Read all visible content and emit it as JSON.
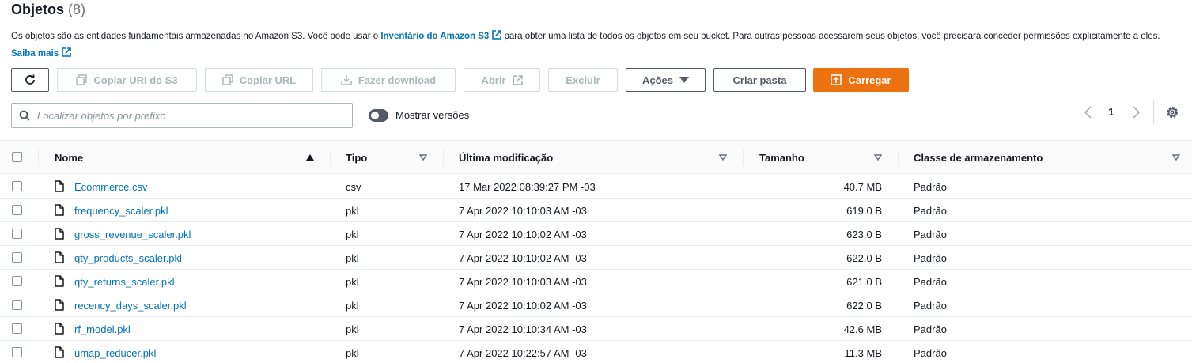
{
  "header": {
    "title": "Objetos",
    "count": "(8)"
  },
  "description": {
    "text1": "Os objetos são as entidades fundamentais armazenadas no Amazon S3. Você pode usar o ",
    "link1": "Inventário do Amazon S3",
    "text2": " para obter uma lista de todos os objetos em seu bucket. Para outras pessoas acessarem seus objetos, você precisará conceder permissões explicitamente a eles. ",
    "link2": "Saiba mais"
  },
  "toolbar": {
    "copy_uri": "Copiar URI do S3",
    "copy_url": "Copiar URL",
    "download": "Fazer download",
    "open": "Abrir",
    "delete": "Excluir",
    "actions": "Ações",
    "create_folder": "Criar pasta",
    "upload": "Carregar"
  },
  "search": {
    "placeholder": "Localizar objetos por prefixo"
  },
  "versions_toggle": {
    "label": "Mostrar versões",
    "on": false
  },
  "pagination": {
    "current_page": "1"
  },
  "colors": {
    "accent_orange": "#ec7211",
    "link_blue": "#0073bb"
  },
  "table": {
    "columns": [
      "Nome",
      "Tipo",
      "Última modificação",
      "Tamanho",
      "Classe de armazenamento"
    ],
    "rows": [
      {
        "name": "Ecommerce.csv",
        "type": "csv",
        "modified": "17 Mar 2022 08:39:27 PM -03",
        "size": "40.7 MB",
        "class": "Padrão"
      },
      {
        "name": "frequency_scaler.pkl",
        "type": "pkl",
        "modified": "7 Apr 2022 10:10:03 AM -03",
        "size": "619.0 B",
        "class": "Padrão"
      },
      {
        "name": "gross_revenue_scaler.pkl",
        "type": "pkl",
        "modified": "7 Apr 2022 10:10:02 AM -03",
        "size": "623.0 B",
        "class": "Padrão"
      },
      {
        "name": "qty_products_scaler.pkl",
        "type": "pkl",
        "modified": "7 Apr 2022 10:10:02 AM -03",
        "size": "622.0 B",
        "class": "Padrão"
      },
      {
        "name": "qty_returns_scaler.pkl",
        "type": "pkl",
        "modified": "7 Apr 2022 10:10:03 AM -03",
        "size": "621.0 B",
        "class": "Padrão"
      },
      {
        "name": "recency_days_scaler.pkl",
        "type": "pkl",
        "modified": "7 Apr 2022 10:10:02 AM -03",
        "size": "622.0 B",
        "class": "Padrão"
      },
      {
        "name": "rf_model.pkl",
        "type": "pkl",
        "modified": "7 Apr 2022 10:10:34 AM -03",
        "size": "42.6 MB",
        "class": "Padrão"
      },
      {
        "name": "umap_reducer.pkl",
        "type": "pkl",
        "modified": "7 Apr 2022 10:22:57 AM -03",
        "size": "11.3 MB",
        "class": "Padrão"
      }
    ]
  }
}
